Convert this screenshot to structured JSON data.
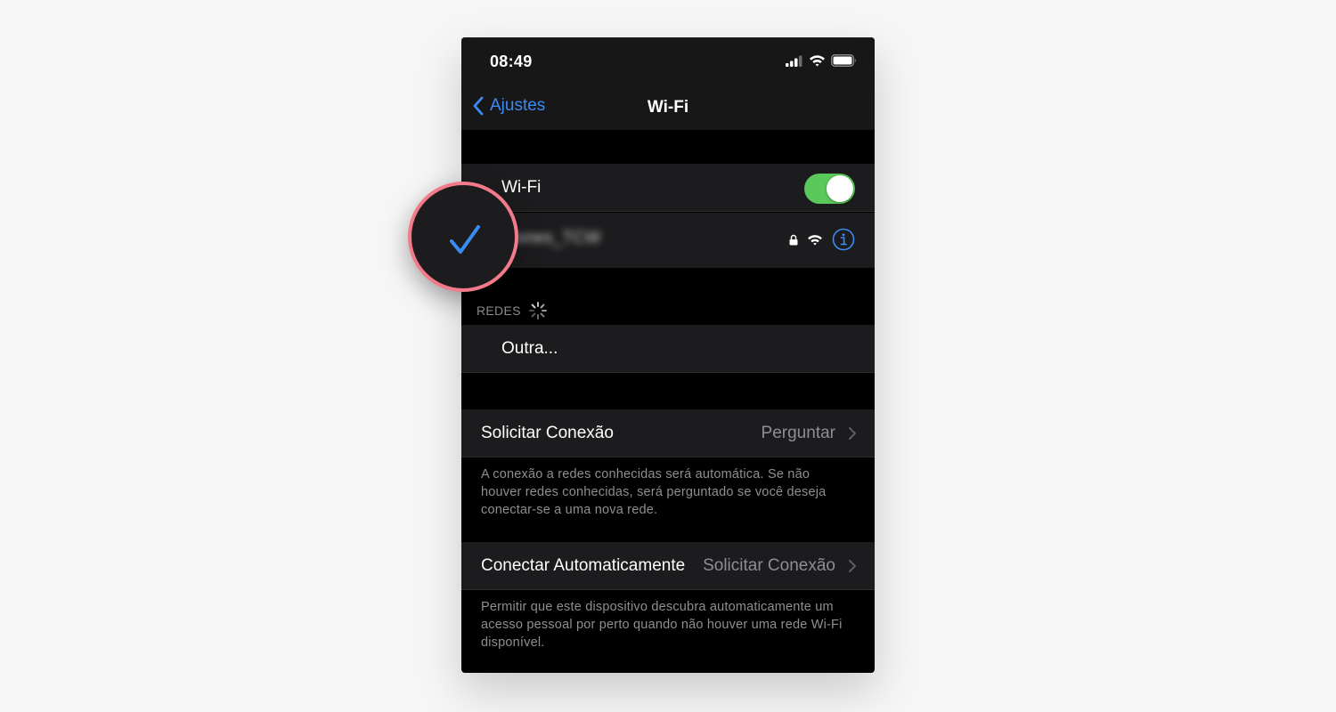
{
  "status_bar": {
    "time": "08:49"
  },
  "nav": {
    "back_label": "Ajustes",
    "title": "Wi-Fi"
  },
  "wifi_row": {
    "label": "Wi-Fi",
    "enabled": true
  },
  "connected_network": {
    "name": "Jones_TCW",
    "secured": true,
    "selected": true
  },
  "networks_section": {
    "header": "REDES",
    "loading": true,
    "other_label": "Outra..."
  },
  "ask_to_join": {
    "label": "Solicitar Conexão",
    "value": "Perguntar",
    "footer": "A conexão a redes conhecidas será automática. Se não houver redes conhecidas, será perguntado se você deseja conectar-se a uma nova rede."
  },
  "auto_join": {
    "label": "Conectar Automaticamente",
    "value": "Solicitar Conexão",
    "footer": "Permitir que este dispositivo descubra automaticamente um acesso pessoal por perto quando não houver uma rede Wi-Fi disponível."
  },
  "colors": {
    "accent_blue": "#3b8bf5",
    "toggle_green": "#5ac85a",
    "highlight_ring": "#f27a8a"
  }
}
